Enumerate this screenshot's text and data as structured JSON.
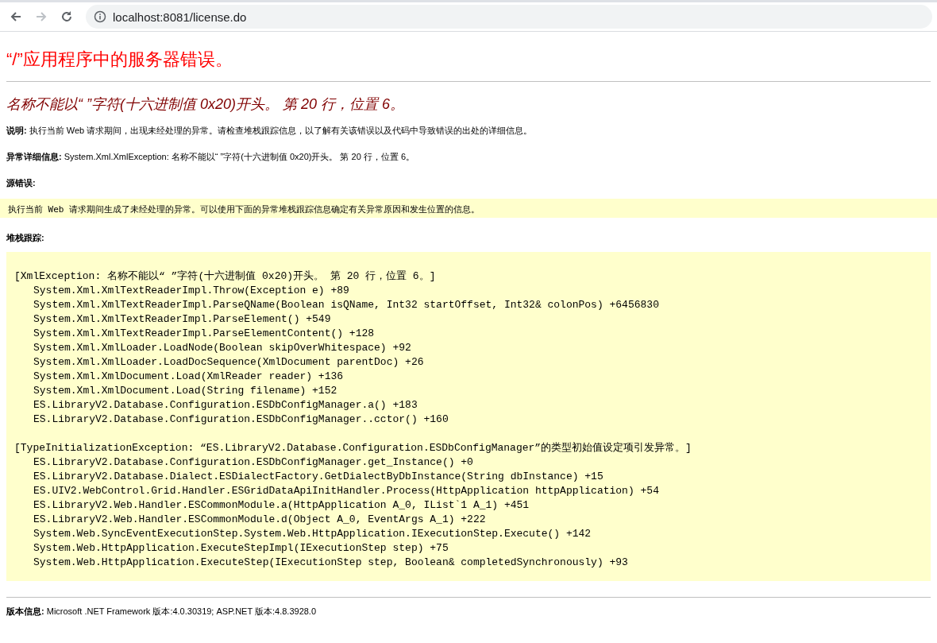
{
  "browser": {
    "back_disabled": false,
    "forward_disabled": true,
    "url": "localhost:8081/license.do"
  },
  "page": {
    "title": "“/”应用程序中的服务器错误。",
    "error_heading": "名称不能以“ ”字符(十六进制值 0x20)开头。 第 20 行，位置 6。",
    "paragraphs": [
      "**说明:** 执行当前 Web 请求期间，出现未经处理的异常。请检查堆栈跟踪信息，以了解有关该错误以及代码中导致错误的出处的详细信息。",
      "**异常详细信息:** System.Xml.XmlException: 名称不能以“ ”字符(十六进制值 0x20)开头。 第 20 行，位置 6。"
    ],
    "source_error_label": "源错误:",
    "source_error_text": "执行当前 Web 请求期间生成了未经处理的异常。可以使用下面的异常堆栈跟踪信息确定有关异常原因和发生位置的信息。",
    "stack_trace_label": "堆栈跟踪:",
    "stack_trace": [
      {
        "header": "[XmlException: 名称不能以“ ”字符(十六进制值 0x20)开头。 第 20 行，位置 6。]",
        "frames": [
          "System.Xml.XmlTextReaderImpl.Throw(Exception e) +89",
          "System.Xml.XmlTextReaderImpl.ParseQName(Boolean isQName, Int32 startOffset, Int32& colonPos) +6456830",
          "System.Xml.XmlTextReaderImpl.ParseElement() +549",
          "System.Xml.XmlTextReaderImpl.ParseElementContent() +128",
          "System.Xml.XmlLoader.LoadNode(Boolean skipOverWhitespace) +92",
          "System.Xml.XmlLoader.LoadDocSequence(XmlDocument parentDoc) +26",
          "System.Xml.XmlDocument.Load(XmlReader reader) +136",
          "System.Xml.XmlDocument.Load(String filename) +152",
          "ES.LibraryV2.Database.Configuration.ESDbConfigManager.a() +183",
          "ES.LibraryV2.Database.Configuration.ESDbConfigManager..cctor() +160"
        ]
      },
      {
        "header": "[TypeInitializationException: “ES.LibraryV2.Database.Configuration.ESDbConfigManager”的类型初始值设定项引发异常。]",
        "frames": [
          "ES.LibraryV2.Database.Configuration.ESDbConfigManager.get_Instance() +0",
          "ES.LibraryV2.Database.Dialect.ESDialectFactory.GetDialectByDbInstance(String dbInstance) +15",
          "ES.UIV2.WebControl.Grid.Handler.ESGridDataApiInitHandler.Process(HttpApplication httpApplication) +54",
          "ES.LibraryV2.Web.Handler.ESCommonModule.a(HttpApplication A_0, IList`1 A_1) +451",
          "ES.LibraryV2.Web.Handler.ESCommonModule.d(Object A_0, EventArgs A_1) +222",
          "System.Web.SyncEventExecutionStep.System.Web.HttpApplication.IExecutionStep.Execute() +142",
          "System.Web.HttpApplication.ExecuteStepImpl(IExecutionStep step) +75",
          "System.Web.HttpApplication.ExecuteStep(IExecutionStep step, Boolean& completedSynchronously) +93"
        ]
      }
    ],
    "version_info": "**版本信息:** Microsoft .NET Framework 版本:4.0.30319; ASP.NET 版本:4.8.3928.0"
  }
}
